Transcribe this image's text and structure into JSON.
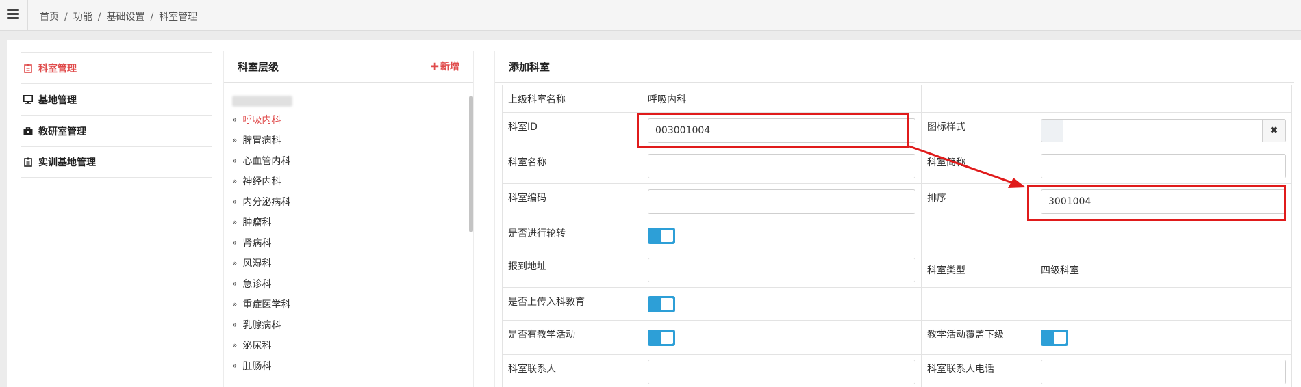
{
  "breadcrumb": [
    "首页",
    "功能",
    "基础设置",
    "科室管理"
  ],
  "leftmenu": {
    "items": [
      {
        "label": "科室管理",
        "active": true,
        "icon": "clipboard-icon"
      },
      {
        "label": "基地管理",
        "active": false,
        "icon": "monitor-icon"
      },
      {
        "label": "教研室管理",
        "active": false,
        "icon": "briefcase-icon"
      },
      {
        "label": "实训基地管理",
        "active": false,
        "icon": "clipboard-icon"
      }
    ]
  },
  "tree": {
    "title": "科室层级",
    "add_label": "新增",
    "items": [
      "呼吸内科",
      "脾胃病科",
      "心血管内科",
      "神经内科",
      "内分泌病科",
      "肿瘤科",
      "肾病科",
      "风湿科",
      "急诊科",
      "重症医学科",
      "乳腺病科",
      "泌尿科",
      "肛肠科"
    ]
  },
  "form": {
    "title": "添加科室",
    "parent_label": "上级科室名称",
    "parent_value": "呼吸内科",
    "dept_id_label": "科室ID",
    "dept_id_value": "003001004",
    "icon_style_label": "图标样式",
    "icon_style_value": "",
    "dept_name_label": "科室名称",
    "dept_name_value": "",
    "short_name_label": "科室简称",
    "short_name_value": "",
    "dept_code_label": "科室编码",
    "dept_code_value": "",
    "sort_label": "排序",
    "sort_value": "3001004",
    "rotation_label": "是否进行轮转",
    "rotation_on": true,
    "address_label": "报到地址",
    "address_value": "",
    "dept_type_label": "科室类型",
    "dept_type_value": "四级科室",
    "upload_label": "是否上传入科教育",
    "upload_on": true,
    "teaching_label": "是否有教学活动",
    "teaching_on": true,
    "teaching_cover_label": "教学活动覆盖下级",
    "teaching_cover_on": true,
    "contact_label": "科室联系人",
    "contact_value": "",
    "contact_phone_label": "科室联系人电话",
    "contact_phone_value": ""
  },
  "colors": {
    "accent_red": "#e04b4b",
    "toggle_blue": "#2d9fd7",
    "annotation_red": "#e01b1b"
  }
}
